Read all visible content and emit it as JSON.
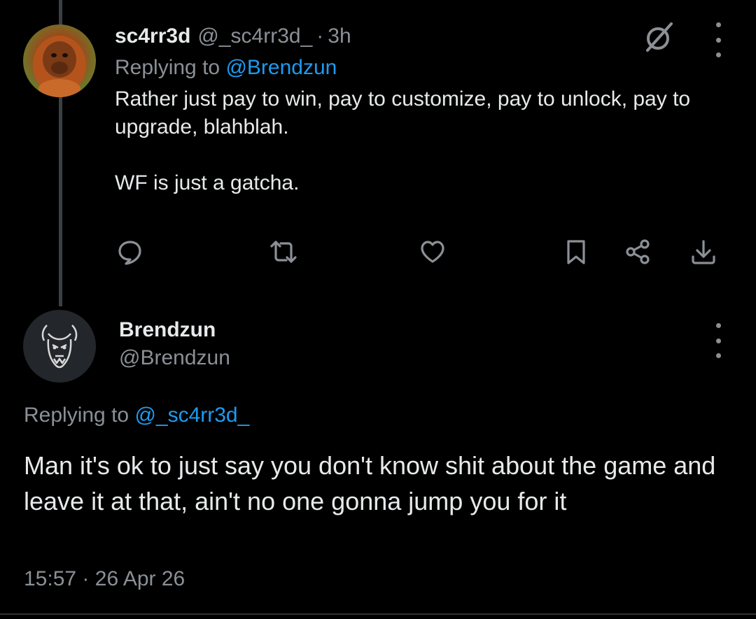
{
  "tweet1": {
    "name": "sc4rr3d",
    "handle": "@_sc4rr3d_",
    "separator": "·",
    "time": "3h",
    "replying_prefix": "Replying to",
    "replying_to": "@Brendzun",
    "text_para1": "Rather just pay to win, pay to customize, pay to unlock, pay to upgrade, blahblah.",
    "text_para2": "WF is just a gatcha.",
    "icons": [
      "grok-icon",
      "more-icon",
      "reply-icon",
      "retweet-icon",
      "like-icon",
      "bookmark-icon",
      "share-icon",
      "download-icon"
    ]
  },
  "tweet2": {
    "name": "Brendzun",
    "handle": "@Brendzun",
    "replying_prefix": "Replying to",
    "replying_to": "@_sc4rr3d_",
    "text": "Man it's ok to just say you don't know shit about the game and leave it at that, ain't no one gonna jump you for it",
    "time": "15:57",
    "separator": "·",
    "date": "26 Apr 26"
  },
  "colors": {
    "background": "#000000",
    "text": "#e7e9ea",
    "secondary": "#8b9096",
    "link": "#1d9bf0",
    "thread_line": "#3b3f44"
  }
}
